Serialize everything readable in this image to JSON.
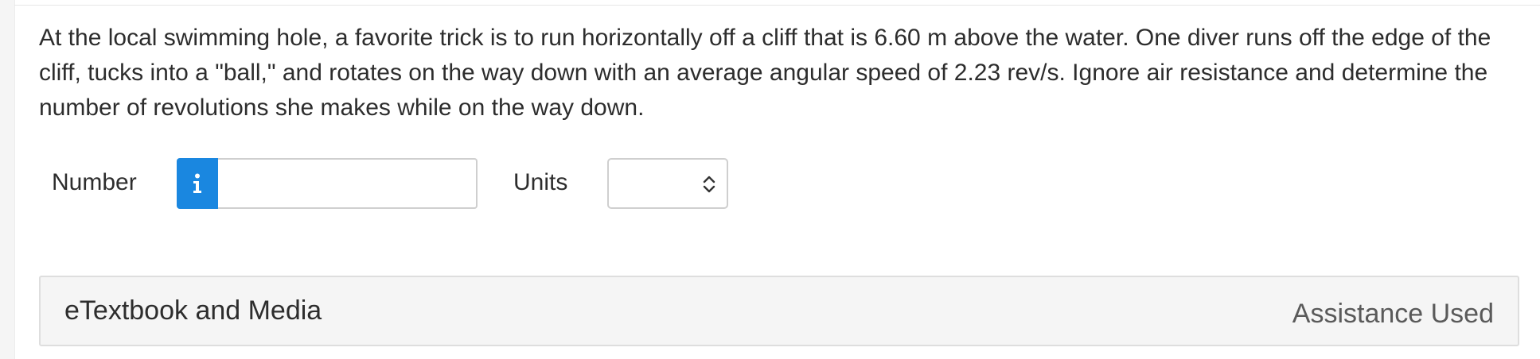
{
  "question": {
    "text": "At the local swimming hole, a favorite trick is to run horizontally off a cliff that is 6.60 m above the water. One diver runs off the edge of the cliff, tucks into a \"ball,\" and rotates on the way down with an average angular speed of 2.23 rev/s. Ignore air resistance and determine the number of revolutions she makes while on the way down."
  },
  "answer": {
    "number_label": "Number",
    "number_value": "",
    "info_icon": "info-icon",
    "units_label": "Units",
    "units_selected": "",
    "units_icon": "chevron-updown-icon"
  },
  "assistance": {
    "title": "eTextbook and Media",
    "status": "Assistance Used"
  },
  "colors": {
    "info_button": "#1a87e0",
    "panel_background": "#f5f5f5",
    "text": "#2d2d2d"
  }
}
